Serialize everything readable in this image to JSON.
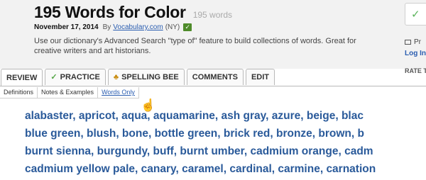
{
  "header": {
    "title": "195 Words for Color",
    "word_count": "195 words",
    "date": "November 17, 2014",
    "by": "By",
    "author": "Vocabulary.com",
    "location": "(NY)",
    "description": "Use our dictionary's Advanced Search \"type of\" feature to build collections of words. Great for creative writers and art historians."
  },
  "right_panel": {
    "check": "✓",
    "print_label": "Pr",
    "login_label": "Log In",
    "rate_label": "RATE T"
  },
  "tabs": [
    {
      "label": "REVIEW",
      "active": true
    },
    {
      "label": "PRACTICE",
      "icon": "check-icon"
    },
    {
      "label": "SPELLING BEE",
      "icon": "bee-icon"
    },
    {
      "label": "COMMENTS"
    },
    {
      "label": "EDIT"
    }
  ],
  "subtabs": [
    {
      "label": "Definitions"
    },
    {
      "label": "Notes & Examples"
    },
    {
      "label": "Words Only",
      "active": true
    }
  ],
  "words": {
    "line1": "alabaster,  apricot,  aqua,  aquamarine,  ash gray,  azure,  beige,  blac",
    "line2": "blue green,  blush,  bone,  bottle green,  brick red,  bronze,  brown,  b",
    "line3": "burnt sienna,  burgundy,  buff,  burnt umber,  cadmium orange,  cadm",
    "line4": "cadmium yellow pale,  canary,  caramel,  cardinal,  carmine,  carnation"
  },
  "colors": {
    "link": "#2a5db0",
    "word": "#2a5a9a",
    "check_green": "#55a647"
  }
}
